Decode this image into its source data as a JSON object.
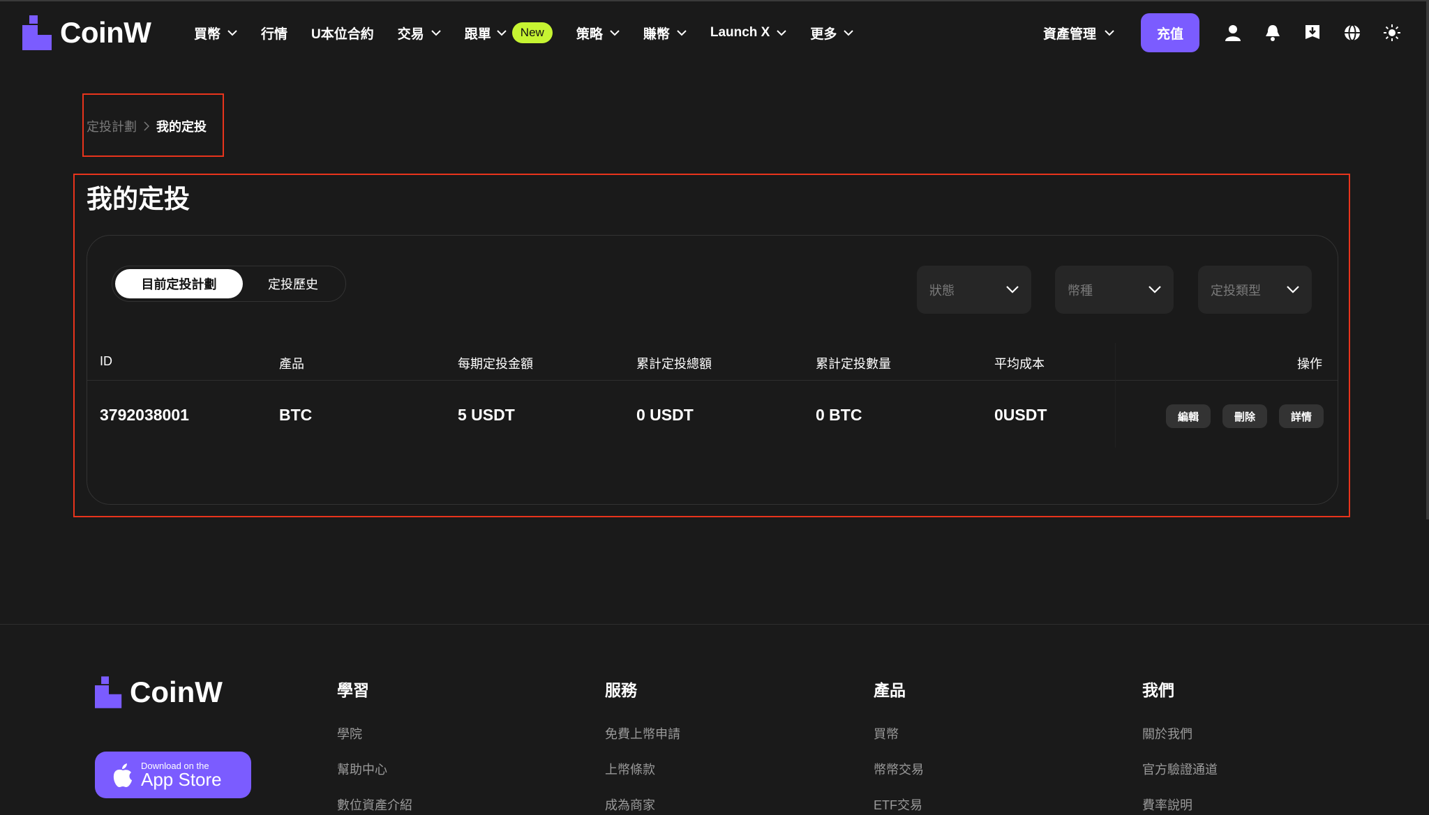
{
  "brand": {
    "name": "CoinW",
    "accent": "#7b5cff",
    "new_badge_color": "#c6f432",
    "highlight_border": "#e8341c"
  },
  "nav": {
    "items": [
      {
        "label": "買幣",
        "dropdown": true
      },
      {
        "label": "行情",
        "dropdown": false
      },
      {
        "label": "U本位合約",
        "dropdown": false
      },
      {
        "label": "交易",
        "dropdown": true
      },
      {
        "label": "跟單",
        "dropdown": true,
        "badge": "New"
      },
      {
        "label": "策略",
        "dropdown": true
      },
      {
        "label": "賺幣",
        "dropdown": true
      },
      {
        "label": "Launch X",
        "dropdown": true
      },
      {
        "label": "更多",
        "dropdown": true
      }
    ],
    "asset_management": "資產管理",
    "deposit": "充值",
    "icons": [
      "user-icon",
      "bell-icon",
      "download-icon",
      "globe-icon",
      "sun-icon"
    ]
  },
  "breadcrumb": {
    "parent": "定投計劃",
    "current": "我的定投"
  },
  "page": {
    "title": "我的定投"
  },
  "tabs": {
    "active": "目前定投計劃",
    "inactive": "定投歷史"
  },
  "filters": {
    "status": "狀態",
    "coin": "幣種",
    "type": "定投類型"
  },
  "table": {
    "headers": [
      "ID",
      "產品",
      "每期定投金額",
      "累計定投總額",
      "累計定投數量",
      "平均成本",
      "操作"
    ],
    "rows": [
      {
        "id": "3792038001",
        "product": "BTC",
        "per_period": "5 USDT",
        "total_amount": "0 USDT",
        "total_qty": "0 BTC",
        "avg_cost": "0USDT"
      }
    ],
    "actions": {
      "edit": "編輯",
      "delete": "刪除",
      "details": "詳情"
    }
  },
  "footer": {
    "app_store": {
      "small": "Download on the",
      "big": "App Store"
    },
    "columns": [
      {
        "title": "學習",
        "links": [
          "學院",
          "幫助中心",
          "數位資產介紹"
        ]
      },
      {
        "title": "服務",
        "links": [
          "免費上幣申請",
          "上幣條款",
          "成為商家"
        ]
      },
      {
        "title": "產品",
        "links": [
          "買幣",
          "幣幣交易",
          "ETF交易"
        ]
      },
      {
        "title": "我們",
        "links": [
          "關於我們",
          "官方驗證通道",
          "費率說明"
        ]
      }
    ]
  }
}
